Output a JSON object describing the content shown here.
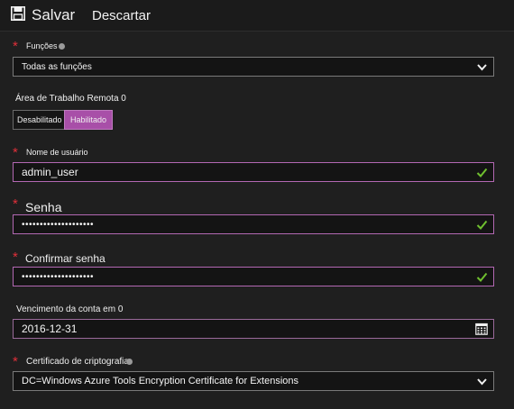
{
  "toolbar": {
    "save_label": "Salvar",
    "discard_label": "Descartar"
  },
  "functions": {
    "label": "Funções",
    "value": "Todas as funções"
  },
  "remote_desktop": {
    "label": "Área de Trabalho Remota",
    "info": "0",
    "options": [
      "Desabilitado",
      "Habilitado"
    ],
    "selected": "Habilitado"
  },
  "username": {
    "label": "Nome de usuário",
    "value": "admin_user"
  },
  "password": {
    "label": "Senha",
    "value": "••••••••••••••••••••"
  },
  "confirm_password": {
    "label": "Confirmar senha",
    "value": "••••••••••••••••••••"
  },
  "expiration": {
    "label": "Vencimento da conta em",
    "info": "0",
    "value": "2016-12-31"
  },
  "certificate": {
    "label": "Certificado de criptografia",
    "value": "DC=Windows Azure Tools Encryption Certificate for Extensions"
  },
  "colors": {
    "required_asterisk": "#e0303a",
    "active_border": "#b368b3",
    "toggle_selected": "#a84fa8",
    "valid_check": "#6fbf2f"
  },
  "icons": [
    "save-icon",
    "info-icon",
    "chevron-down-icon",
    "check-icon",
    "calendar-icon"
  ]
}
